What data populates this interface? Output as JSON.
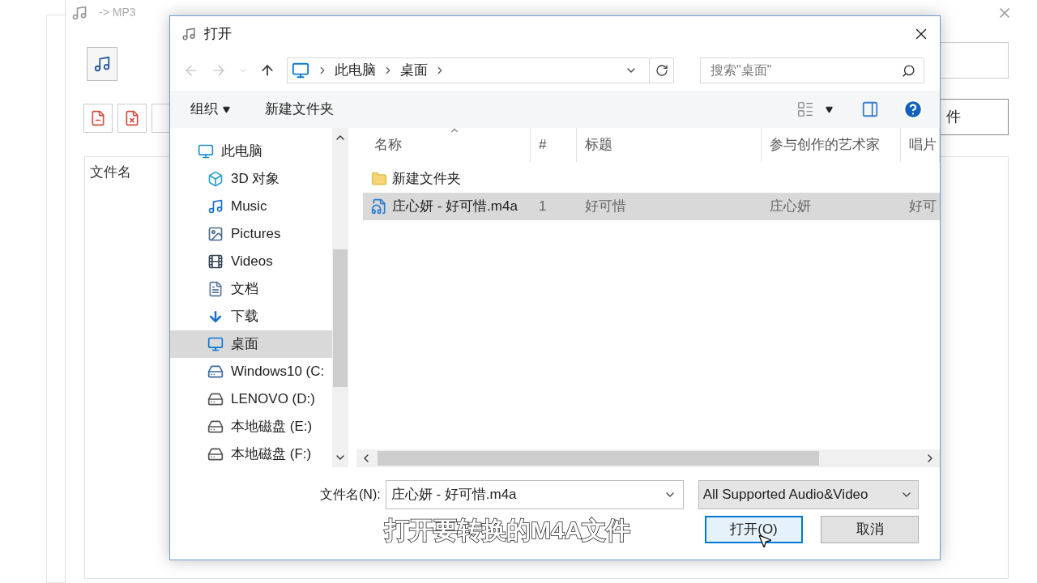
{
  "background_window": {
    "title": "-> MP3",
    "list_header": "文件名",
    "side_button": "件"
  },
  "dialog": {
    "title": "打开",
    "address": {
      "segments": [
        "此电脑",
        "桌面"
      ]
    },
    "search": {
      "placeholder": "搜索\"桌面\""
    },
    "toolbar": {
      "organize": "组织",
      "new_folder": "新建文件夹"
    },
    "nav_tree": [
      {
        "label": "此电脑",
        "kind": "computer",
        "selected": false,
        "children": [
          {
            "label": "3D 对象",
            "kind": "objects",
            "selected": false
          },
          {
            "label": "Music",
            "kind": "music",
            "selected": false
          },
          {
            "label": "Pictures",
            "kind": "pictures",
            "selected": false
          },
          {
            "label": "Videos",
            "kind": "videos",
            "selected": false
          },
          {
            "label": "文档",
            "kind": "documents",
            "selected": false
          },
          {
            "label": "下载",
            "kind": "downloads",
            "selected": false
          },
          {
            "label": "桌面",
            "kind": "desktop",
            "selected": true
          },
          {
            "label": "Windows10 (C:",
            "kind": "system_drive",
            "selected": false
          },
          {
            "label": "LENOVO (D:)",
            "kind": "drive",
            "selected": false
          },
          {
            "label": "本地磁盘 (E:)",
            "kind": "drive",
            "selected": false
          },
          {
            "label": "本地磁盘 (F:)",
            "kind": "drive",
            "selected": false
          }
        ]
      }
    ],
    "columns": [
      "名称",
      "#",
      "标题",
      "参与创作的艺术家",
      "唱片"
    ],
    "rows": [
      {
        "kind": "folder",
        "selected": false,
        "cells": [
          "新建文件夹"
        ]
      },
      {
        "kind": "audio",
        "selected": true,
        "cells": [
          "庄心妍 - 好可惜.m4a",
          "1",
          "好可惜",
          "庄心妍",
          "好可"
        ]
      }
    ],
    "file_name": {
      "label": "文件名(N):",
      "value": "庄心妍 - 好可惜.m4a"
    },
    "file_type": {
      "value": "All Supported Audio&Video"
    },
    "buttons": [
      {
        "label": "打开(O)",
        "default": true
      },
      {
        "label": "取消",
        "default": false
      }
    ]
  },
  "caption": "打开要转换的M4A文件"
}
